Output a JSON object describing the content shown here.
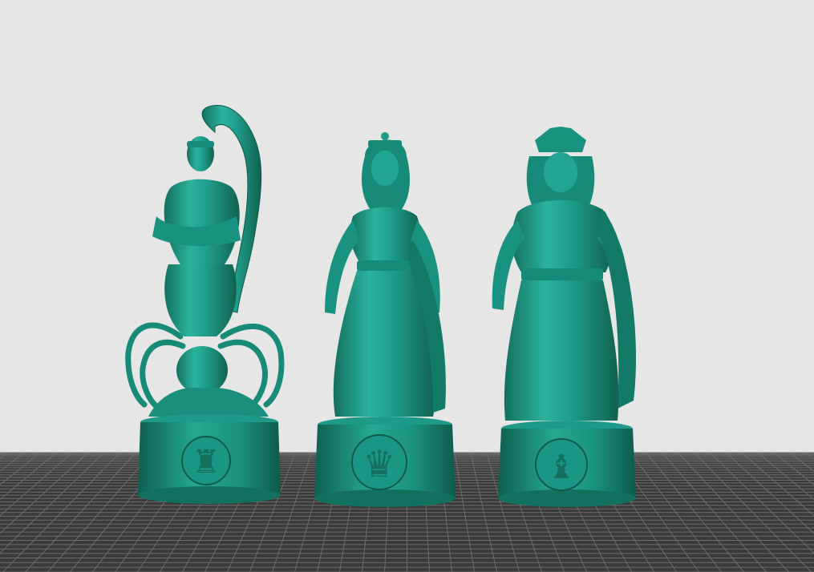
{
  "scene": {
    "type": "3d-print-slicer-viewport",
    "background_color": "#e6e6e6",
    "bed_grid_color": "#6e6e6e",
    "bed_base_color": "#3a3a3a",
    "model_color": "#1f9a88",
    "model_shadow_color": "#13705f",
    "model_highlight_color": "#3fc6b0",
    "models": [
      {
        "name": "scorpion-warrior-rook",
        "chess_piece": "rook",
        "symbol": "♜"
      },
      {
        "name": "warrior-queen",
        "chess_piece": "queen",
        "symbol": "♛"
      },
      {
        "name": "pharaoh-bishop",
        "chess_piece": "bishop",
        "symbol": "♝"
      }
    ]
  }
}
